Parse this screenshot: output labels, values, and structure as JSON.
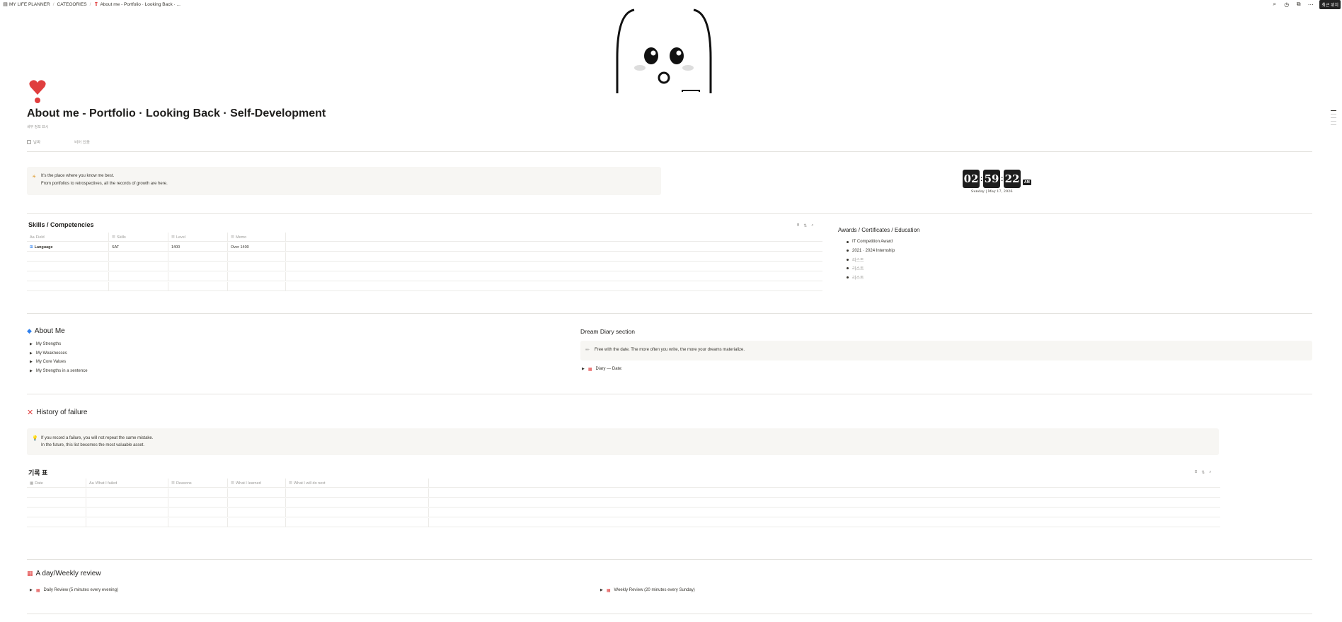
{
  "breadcrumbs": [
    {
      "icon": "planner-icon",
      "label": "MY LIFE PLANNER"
    },
    {
      "label": "CATEGORIES"
    },
    {
      "icon": "heart-icon",
      "label": "About me - Portfolio · Looking Back · ..."
    }
  ],
  "topbar": {
    "badge": "최근 위치"
  },
  "page": {
    "title": "About me - Portfolio · Looking Back · Self-Development",
    "subnote": "세부 정보 표시",
    "props": [
      {
        "label": "날짜"
      },
      {
        "label": "비어 있음"
      }
    ]
  },
  "intro_callout": {
    "icon": "☀",
    "lines": [
      "It's the place where you know me best.",
      "From portfolios to retrospectives, all the records of growth are here."
    ]
  },
  "clock": {
    "h": "02",
    "m": "59",
    "s": "22",
    "ampm": "AM",
    "date": "Sunday | May 17, 2026"
  },
  "skills": {
    "title": "Skills / Competencies",
    "columns": [
      "Field",
      "Skills",
      "Level",
      "Memo"
    ],
    "rows": [
      {
        "field": "Language",
        "skills": "SAT",
        "level": "1400",
        "memo": "Over 1400"
      }
    ]
  },
  "awards": {
    "title": "Awards / Certificates / Education",
    "items": [
      "IT Competition Award",
      "2021 · 2024 Internship",
      "리스트",
      "리스트",
      "리스트"
    ]
  },
  "about_me": {
    "title": "About Me",
    "items": [
      "My Strengths",
      "My Weaknesses",
      "My Core Values",
      "My Strengths in a sentence"
    ]
  },
  "dream": {
    "title": "Dream Diary section",
    "callout": "Free with the date. The more often you write, the more your dreams materialize.",
    "toggle": "Diary — Date:"
  },
  "failure": {
    "title": "History of failure",
    "callout_lines": [
      "If you record a failure, you will not repeat the same mistake.",
      "In the future, this list becomes the most valuable asset."
    ],
    "table_title": "기록 표",
    "columns": [
      "Date",
      "What I failed",
      "Reasons",
      "What I learned",
      "What I will do next"
    ]
  },
  "review": {
    "title": "A day/Weekly review",
    "daily": "Daily Review (5 minutes every evening)",
    "weekly": "Weekly Review (20 minutes every Sunday)"
  },
  "colors": {
    "accent_red": "#e03e3e",
    "callout_bg": "#f7f6f3",
    "text": "#37352f"
  }
}
